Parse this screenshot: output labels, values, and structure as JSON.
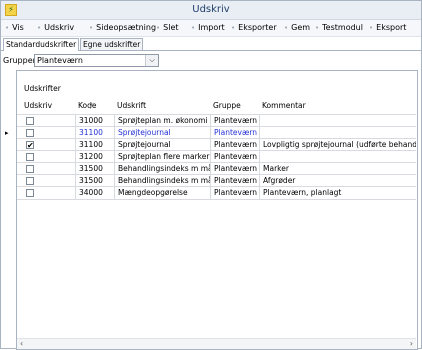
{
  "window": {
    "title": "Udskriv"
  },
  "menu": {
    "items": [
      {
        "label": "Vis"
      },
      {
        "label": "Udskriv"
      },
      {
        "label": "Sideopsætning"
      },
      {
        "label": "Slet"
      },
      {
        "label": "Import"
      },
      {
        "label": "Eksporter"
      },
      {
        "label": "Gem"
      },
      {
        "label": "Testmodul"
      },
      {
        "label": "Eksport"
      }
    ]
  },
  "tabs": [
    {
      "label": "Standardudskrifter",
      "active": true
    },
    {
      "label": "Egne udskrifter",
      "active": false
    }
  ],
  "filter": {
    "label": "Grupper",
    "value": "Planteværn"
  },
  "panel": {
    "title": "Udskrifter"
  },
  "table": {
    "columns": [
      "Udskriv",
      "Kode",
      "Udskrift",
      "Gruppe",
      "Kommentar"
    ],
    "sort_glyph": "/",
    "rows": [
      {
        "checked": false,
        "check_glyph": "",
        "kode": "31000",
        "udskrift": "Sprøjteplan m. økonomi",
        "gruppe": "Planteværn",
        "kommentar": ""
      },
      {
        "checked": false,
        "check_glyph": "",
        "kode": "31100",
        "udskrift": "Sprøjtejournal",
        "gruppe": "Planteværn",
        "kommentar": "",
        "selected": true
      },
      {
        "checked": true,
        "check_glyph": "✔",
        "kode": "31100",
        "udskrift": "Sprøjtejournal",
        "gruppe": "Planteværn",
        "kommentar": "Lovpligtig sprøjtejournal (udførte behandlinger)"
      },
      {
        "checked": false,
        "check_glyph": "",
        "kode": "31200",
        "udskrift": "Sprøjteplan flere marker",
        "gruppe": "Planteværn",
        "kommentar": ""
      },
      {
        "checked": false,
        "check_glyph": "",
        "kode": "31500",
        "udskrift": "Behandlingsindeks m måltal",
        "gruppe": "Planteværn",
        "kommentar": "Marker"
      },
      {
        "checked": false,
        "check_glyph": "",
        "kode": "31500",
        "udskrift": "Behandlingsindeks m måltal",
        "gruppe": "Planteværn",
        "kommentar": "Afgrøder"
      },
      {
        "checked": false,
        "check_glyph": "",
        "kode": "34000",
        "udskrift": "Mængdeopgørelse",
        "gruppe": "Planteværn",
        "kommentar": "Planteværn, planlagt"
      }
    ]
  },
  "icons": {
    "app": "app-icon",
    "row_indicator": "▸",
    "select_arrow": "⌵",
    "scroll_left": "‹",
    "scroll_right": "›"
  }
}
